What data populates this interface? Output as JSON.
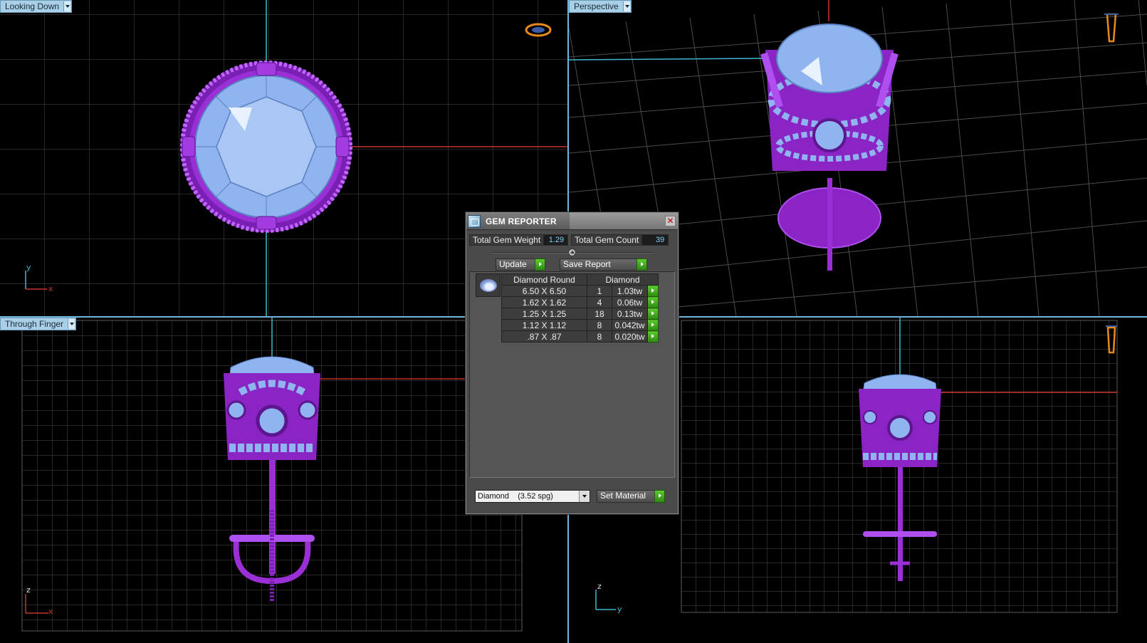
{
  "viewports": {
    "top_left": {
      "label": "Looking Down",
      "axes": [
        "y",
        "x"
      ]
    },
    "top_right": {
      "label": "Perspective"
    },
    "bottom_left": {
      "label": "Through Finger",
      "axes": [
        "z",
        "x"
      ]
    },
    "bottom_right": {
      "axes": [
        "z",
        "y"
      ]
    }
  },
  "dialog": {
    "title": "GEM REPORTER",
    "close_glyph": "✕",
    "total_weight_label": "Total Gem Weight",
    "total_weight_value": "1.29",
    "total_count_label": "Total Gem Count",
    "total_count_value": "39",
    "update_label": "Update",
    "save_report_label": "Save Report",
    "table": {
      "headers": [
        "Diamond Round",
        "Diamond"
      ],
      "rows": [
        {
          "size": "6.50 X 6.50",
          "count": "1",
          "weight": "1.03tw"
        },
        {
          "size": "1.62 X 1.62",
          "count": "4",
          "weight": "0.06tw"
        },
        {
          "size": "1.25 X 1.25",
          "count": "18",
          "weight": "0.13tw"
        },
        {
          "size": "1.12 X 1.12",
          "count": "8",
          "weight": "0.042tw"
        },
        {
          "size": ".87 X .87",
          "count": "8",
          "weight": "0.020tw"
        }
      ]
    },
    "material_select": "Diamond    (3.52 spg)",
    "set_material_label": "Set Material"
  },
  "colors": {
    "metal": "#9b2fd6",
    "gem": "#8fb4ef",
    "grid": "#4b4b4b",
    "axis_red": "#c8312a",
    "axis_cyan": "#3fb7cf",
    "border": "#6fb7d8"
  }
}
